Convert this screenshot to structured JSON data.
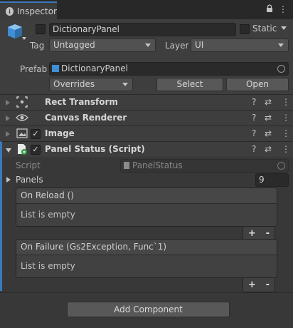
{
  "tab": {
    "label": "Inspector",
    "info_icon": "i"
  },
  "tab_icons": {
    "lock": "lock-icon",
    "menu": "⋮"
  },
  "object": {
    "name": "DictionaryPanel",
    "static_label": "Static",
    "tag_label": "Tag",
    "tag_value": "Untagged",
    "layer_label": "Layer",
    "layer_value": "UI",
    "prefab_label": "Prefab",
    "prefab_value": "DictionaryPanel",
    "overrides_label": "Overrides",
    "select_label": "Select",
    "open_label": "Open"
  },
  "components": [
    {
      "title": "Rect Transform"
    },
    {
      "title": "Canvas Renderer"
    },
    {
      "title": "Image"
    },
    {
      "title": "Panel Status (Script)"
    }
  ],
  "script_section": {
    "script_label": "Script",
    "script_value": "PanelStatus",
    "panels_label": "Panels",
    "panels_value": "9"
  },
  "events": [
    {
      "header": "On Reload ()",
      "body": "List is empty",
      "plus": "+",
      "minus": "-"
    },
    {
      "header": "On Failure (Gs2Exception, Func`1)",
      "body": "List is empty",
      "plus": "+",
      "minus": "-"
    }
  ],
  "add_component_label": "Add Component",
  "colors": {
    "accent": "#3a79bb",
    "background": "#383838",
    "header": "#3e3e3e"
  }
}
